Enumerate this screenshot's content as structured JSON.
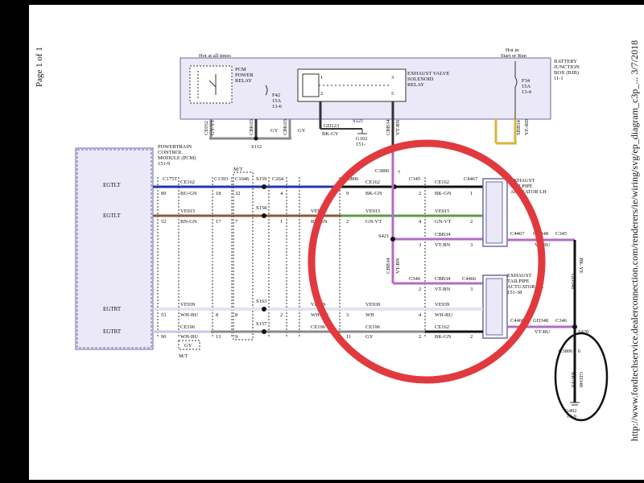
{
  "page": {
    "label": "Page 1 of 1"
  },
  "footer": {
    "url_text": "http://www.fordtechservice.dealerconnection.com/renderers/ie/wiring/svg/ep_diagram_c3p_...  3/7/2018"
  },
  "top": {
    "hot_all_times": "Hot at all times",
    "pcm_relay": [
      "PCM",
      "POWER",
      "RELAY"
    ],
    "f42": [
      "F42",
      "15A",
      "13-6"
    ],
    "exhaust_relay": [
      "EXHAUST VALVE",
      "SOLENOID",
      "RELAY"
    ],
    "hot_start_run": [
      "Hot in",
      "Start or Run"
    ],
    "f34": [
      "F34",
      "15A",
      "13-4"
    ],
    "bjb": [
      "BATTERY",
      "JUNCTION",
      "BOX (BJB)",
      "11-1"
    ],
    "wires": [
      "CE052",
      "GY-VT",
      "CBK03",
      "GY",
      "CBK03",
      "GY",
      "GD123",
      "BK-GY",
      "CBB34",
      "VT-BN",
      "SBB34",
      "YE-RD"
    ],
    "pins": [
      "1",
      "2",
      "3",
      "5"
    ],
    "splices": [
      "S112",
      "S121",
      "G102",
      "151-"
    ]
  },
  "pcm": {
    "label": [
      "POWERTRAIN",
      "CONTROL",
      "MODULE (PCM)",
      "151-9"
    ],
    "pins": [
      "EGTLT",
      "EGTLT",
      "EGTRT",
      "EGTRT"
    ]
  },
  "circuits": {
    "row1": {
      "c1": "C175T",
      "w1": "CE162",
      "p1": "89",
      "c2": "C1393",
      "mt": "M/T",
      "c3": "C1046",
      "s159": "S159",
      "c264": "C264",
      "c3806": "C3806",
      "c345": "C345",
      "c4467": "C4467",
      "color": "BU-GN",
      "bkgn": "BK-GN",
      "pins": [
        "18",
        "32",
        "4",
        "9",
        "2",
        "1"
      ]
    },
    "row2": {
      "w": "VE915",
      "color": "BN-GN",
      "s158": "S158",
      "gnvt": "GN-VT",
      "pins": [
        "52",
        "17",
        "7",
        "1",
        "2",
        "4",
        "2"
      ]
    },
    "row3": {
      "s421": "S421",
      "w": "CBB34",
      "color": "VT-BN",
      "c4467b": "C4467",
      "d348": "GD348",
      "c345b": "C345",
      "pins": [
        "3",
        "3",
        "1",
        "1"
      ]
    },
    "row4": {
      "c346": "C346",
      "w": "CBB34",
      "color": "VT-BN",
      "c4466": "C4466",
      "pins": [
        "2",
        "3"
      ]
    },
    "row5": {
      "s163": "S163",
      "w": "VE939",
      "color": "WH-BU",
      "wh": "WH",
      "pins": [
        "53",
        "8",
        "8",
        "2",
        "3",
        "4"
      ]
    },
    "row6": {
      "s157": "S157",
      "w": "CE196",
      "color": "WH-BU",
      "gy": "GY",
      "ce162": "CE162",
      "bkgn": "BK-GN",
      "pins": [
        "90",
        "13",
        "9",
        "11",
        "2",
        "2"
      ],
      "gy_box": "GY",
      "mt": "M/T"
    },
    "actuator_lh": [
      "EXHAUST",
      "TAILPIPE",
      "ACTUATOR LH"
    ],
    "actuator_rh": [
      "EXHAUST",
      "TAILPIPE",
      "ACTUATOR RH",
      "151-38"
    ],
    "right": {
      "c345": "C345",
      "c346": "C346",
      "gd348": "GD348",
      "bkye": "BK-YE",
      "vtbu": "VT-BU",
      "c3806": "C3806",
      "p6": "6",
      "s420": "S420",
      "g402": [
        "G402",
        "10-9"
      ],
      "p1": "1"
    }
  },
  "colors": {
    "red": "#e13a3e",
    "purple": "#b56bc4",
    "green": "#5e9a4a",
    "brown": "#8a5a3a",
    "blue": "#2437a8",
    "yellow": "#d9b43a",
    "gray": "#8a8a8a",
    "black": "#111"
  }
}
